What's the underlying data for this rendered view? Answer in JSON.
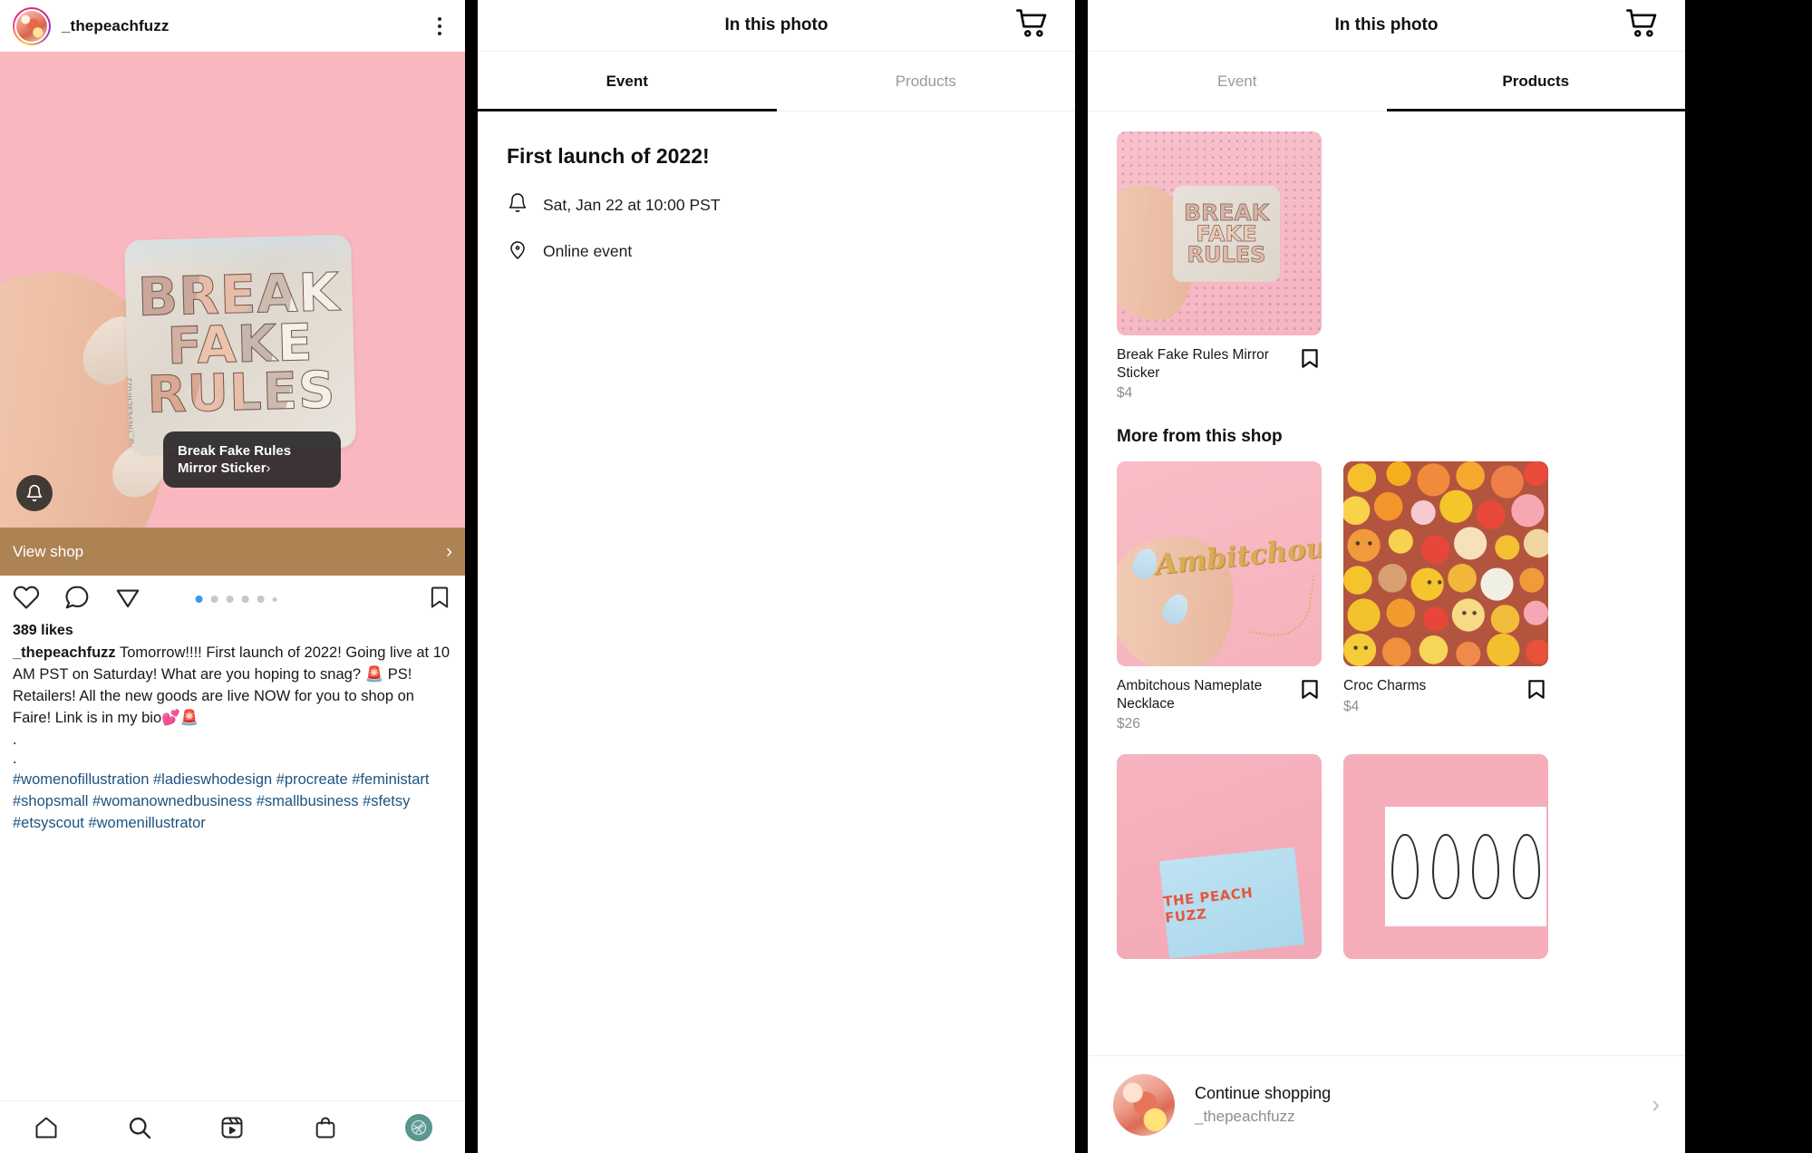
{
  "feed": {
    "username": "_thepeachfuzz",
    "menu_icon": "kebab-menu-icon",
    "product_tag": {
      "label": "Break Fake Rules Mirror Sticker",
      "chevron": "›"
    },
    "sticker_art": {
      "line1": "BREAK",
      "line2": "FAKE",
      "line3": "RULES",
      "credit": "@_THEPEACHFUZZ"
    },
    "view_shop": {
      "label": "View shop",
      "chevron": "›"
    },
    "actions": {
      "like": "heart-icon",
      "comment": "comment-icon",
      "share": "share-icon",
      "save": "bookmark-icon"
    },
    "carousel": {
      "total_dots": 6,
      "active_index": 0
    },
    "likes": "389 likes",
    "caption": {
      "author": "_thepeachfuzz",
      "body": " Tomorrow!!!! First launch of 2022! Going live at 10 AM PST on Saturday! What are you hoping to snag? 🚨 PS! Retailers! All the new goods are live NOW for you to shop on Faire! Link is in my bio💕🚨",
      "spacer1": ".",
      "spacer2": ".",
      "hashtags": "#womenofillustration #ladieswhodesign #procreate #feministart #shopsmall #womanownedbusiness #smallbusiness #sfetsy #etsyscout #womenillustrator"
    },
    "tabbar": [
      {
        "name": "home-icon"
      },
      {
        "name": "search-icon"
      },
      {
        "name": "reels-icon"
      },
      {
        "name": "shop-icon"
      },
      {
        "name": "profile-avatar"
      }
    ]
  },
  "event_sheet": {
    "title": "In this photo",
    "cart_icon": "shopping-cart-icon",
    "tabs": [
      {
        "label": "Event",
        "active": true
      },
      {
        "label": "Products",
        "active": false
      }
    ],
    "event": {
      "name": "First launch of 2022!",
      "date_icon": "bell-icon",
      "date": "Sat, Jan 22 at 10:00 PST",
      "location_icon": "location-pin-icon",
      "location": "Online event"
    }
  },
  "products_sheet": {
    "title": "In this photo",
    "cart_icon": "shopping-cart-icon",
    "tabs": [
      {
        "label": "Event",
        "active": false
      },
      {
        "label": "Products",
        "active": true
      }
    ],
    "featured": {
      "name": "Break Fake Rules Mirror Sticker",
      "price": "$4",
      "save_icon": "bookmark-icon"
    },
    "more_title": "More from this shop",
    "grid": [
      {
        "name": "Ambitchous Nameplate Necklace",
        "price": "$26",
        "save_icon": "bookmark-icon",
        "art": "necklace"
      },
      {
        "name": "Croc Charms",
        "price": "$4",
        "save_icon": "bookmark-icon",
        "art": "croc"
      }
    ],
    "grid_partial": [
      {
        "art": "card",
        "art_label": "THE PEACH FUZZ"
      },
      {
        "art": "prints"
      }
    ],
    "continue": {
      "title": "Continue shopping",
      "subtitle": "_thepeachfuzz",
      "chevron": "›"
    }
  },
  "colors": {
    "accent_blue": "#3897f0",
    "view_shop_bg": "#ad8354",
    "media_pink": "#f9b8c0",
    "hashtag_blue": "#1c5380"
  }
}
